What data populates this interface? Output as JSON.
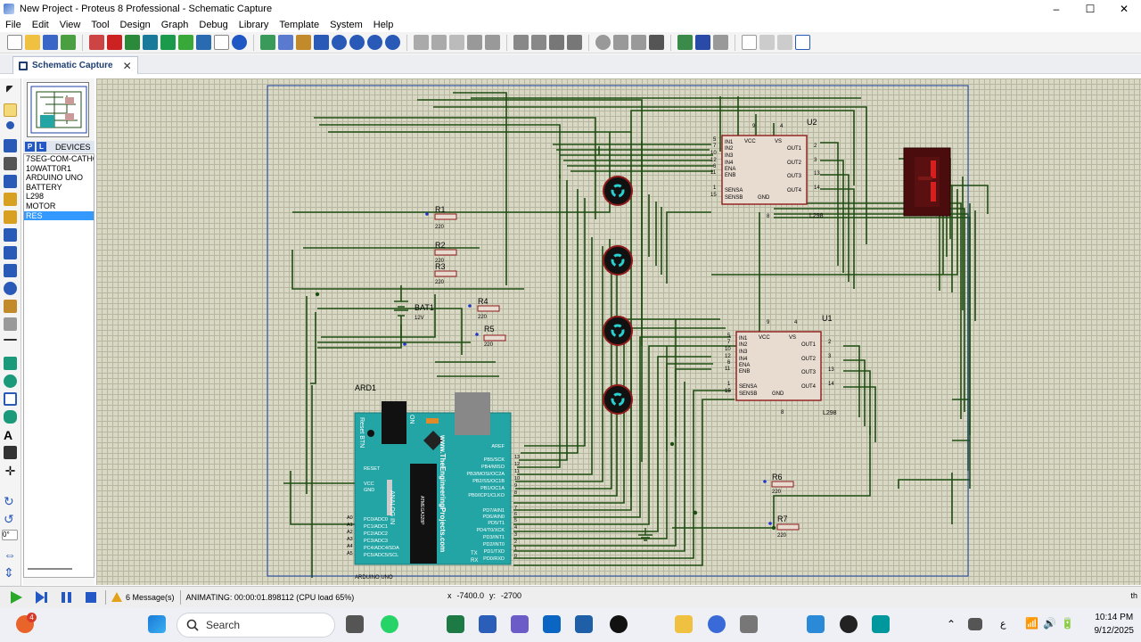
{
  "window": {
    "title": "New Project - Proteus 8 Professional - Schematic Capture",
    "controls": [
      "–",
      "☐",
      "✕"
    ]
  },
  "menu": [
    "File",
    "Edit",
    "View",
    "Tool",
    "Design",
    "Graph",
    "Debug",
    "Library",
    "Template",
    "System",
    "Help"
  ],
  "tab": {
    "label": "Schematic Capture",
    "close": "✕"
  },
  "devices": {
    "p_label": "P",
    "l_label": "L",
    "header": "DEVICES",
    "items": [
      "7SEG-COM-CATHODE",
      "10WATT0R1",
      "ARDUINO UNO",
      "BATTERY",
      "L298",
      "MOTOR",
      "RES"
    ],
    "selected": "RES"
  },
  "schematic": {
    "resistors": [
      {
        "ref": "R1",
        "value": "220"
      },
      {
        "ref": "R2",
        "value": "220"
      },
      {
        "ref": "R3",
        "value": "220"
      },
      {
        "ref": "R4",
        "value": "220"
      },
      {
        "ref": "R5",
        "value": "220"
      },
      {
        "ref": "R6",
        "value": "220"
      },
      {
        "ref": "R7",
        "value": "220"
      }
    ],
    "battery": {
      "ref": "BAT1",
      "value": "12V"
    },
    "driver_u2": {
      "ref": "U2",
      "part": "L298"
    },
    "driver_u1": {
      "ref": "U1",
      "part": "L298"
    },
    "arduino": {
      "ref": "ARD1",
      "part": "ARDUINO UNO",
      "watermark": "www.TheEngineeringProjects.com",
      "reset_label": "Reset BTN",
      "on_label": "ON",
      "analog_label": "ANALOG IN",
      "chip_label": "ATMEGA328P"
    },
    "l298_labels": {
      "left": [
        "IN1",
        "IN2",
        "IN3",
        "IN4",
        "ENA",
        "ENB",
        "SENSA",
        "SENSB"
      ],
      "top": [
        "VCC",
        "VS"
      ],
      "right": [
        "OUT1",
        "OUT2",
        "OUT3",
        "OUT4"
      ],
      "bottom": "GND",
      "left_pins": [
        "5",
        "7",
        "10",
        "12",
        "6",
        "11",
        "1",
        "15"
      ],
      "right_pins": [
        "2",
        "3",
        "13",
        "14"
      ],
      "top_pins": [
        "9",
        "4"
      ],
      "bottom_pin": "8"
    },
    "arduino_labels": {
      "left": [
        "RESET",
        "VCC",
        "GND",
        "PC0/ADC0",
        "PC1/ADC1",
        "PC2/ADC2",
        "PC3/ADC3",
        "PC4/ADC4/SDA",
        "PC5/ADC5/SCL"
      ],
      "left_pins": [
        "A0",
        "A1",
        "A2",
        "A3",
        "A4",
        "A5"
      ],
      "right_top": [
        "AREF",
        "PB5/SCK",
        "PB4/MISO",
        "PB3/MOSI/OC2A",
        "PB2/SS/OC1B",
        "PB1/OC1A",
        "PB0/ICP1/CLKO"
      ],
      "right_top_pins": [
        "13",
        "12",
        "11",
        "10",
        "9",
        "8"
      ],
      "right_bottom": [
        "PD7/AIN1",
        "PD6/AIN0",
        "PD5/T1",
        "PD4/T0/XCK",
        "PD3/INT1",
        "PD2/INT0",
        "PD1/TXD",
        "PD0/RXD"
      ],
      "right_bottom_pins": [
        "7",
        "6",
        "5",
        "4",
        "3",
        "2",
        "1",
        "0"
      ],
      "tx": "TX",
      "rx": "RX"
    }
  },
  "status": {
    "messages": "6 Message(s)",
    "animation": "ANIMATING: 00:00:01.898112 (CPU load 65%)",
    "x_label": "x",
    "x_value": "-7400.0",
    "y_label": "y:",
    "y_value": "-2700",
    "right_text": "th"
  },
  "taskbar": {
    "search_placeholder": "Search",
    "time": "10:14 PM",
    "date": "9/12/2025",
    "notification_count": "4",
    "language": "ع"
  },
  "colors": {
    "canvas_bg": "#d8d8c4",
    "grid": "#b7b7a1",
    "wire": "#1e4d12",
    "component_fill": "#e8dbd0",
    "component_border": "#8e1a1a",
    "arduino_board": "#24a5a5",
    "seg_display": "#4a0c0c",
    "seg_active": "#d62020"
  }
}
